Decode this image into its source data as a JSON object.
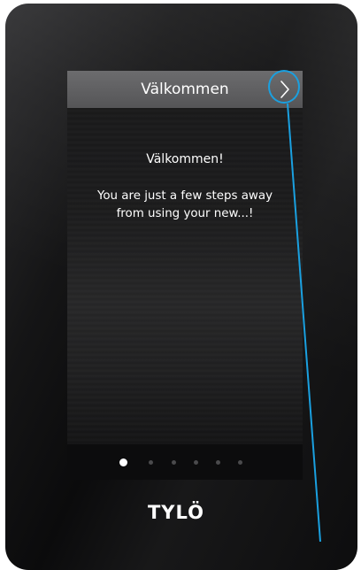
{
  "screen": {
    "header": {
      "title": "Välkommen",
      "next_icon": "chevron-right-icon"
    },
    "content": {
      "heading": "Välkommen!",
      "body_line_1": "You are just a few steps away",
      "body_line_2": "from using your new...!"
    },
    "pager": {
      "total_pages": 7,
      "current_page": 1
    }
  },
  "brand": {
    "logo_text": "TYLÖ"
  },
  "colors": {
    "callout": "#1aa0e0",
    "header_bg": "#5f5f61",
    "text": "#ffffff",
    "active_dot": "#ffffff",
    "inactive_dot": "#4a4a4c"
  }
}
